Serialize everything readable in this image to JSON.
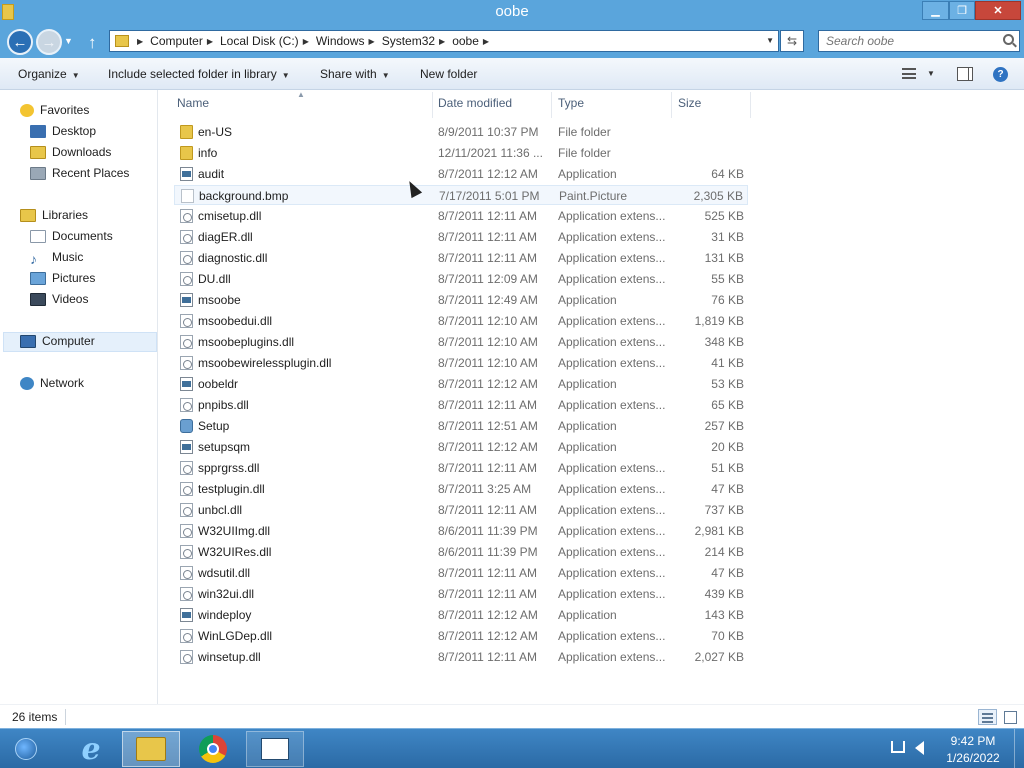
{
  "window": {
    "title": "oobe"
  },
  "address": {
    "crumbs": [
      "Computer",
      "Local Disk (C:)",
      "Windows",
      "System32",
      "oobe"
    ],
    "search_placeholder": "Search oobe"
  },
  "toolbar": {
    "organize": "Organize",
    "include": "Include selected folder in library",
    "share": "Share with",
    "new_folder": "New folder"
  },
  "nav": {
    "favorites": "Favorites",
    "favorites_items": [
      "Desktop",
      "Downloads",
      "Recent Places"
    ],
    "libraries": "Libraries",
    "libraries_items": [
      "Documents",
      "Music",
      "Pictures",
      "Videos"
    ],
    "computer": "Computer",
    "network": "Network"
  },
  "columns": {
    "name": "Name",
    "date": "Date modified",
    "type": "Type",
    "size": "Size"
  },
  "files": [
    {
      "name": "en-US",
      "date": "8/9/2011 10:37 PM",
      "type": "File folder",
      "size": "",
      "icon": "folder-icon"
    },
    {
      "name": "info",
      "date": "12/11/2021 11:36 ...",
      "type": "File folder",
      "size": "",
      "icon": "folder-icon"
    },
    {
      "name": "audit",
      "date": "8/7/2011 12:12 AM",
      "type": "Application",
      "size": "64 KB",
      "icon": "app-icon"
    },
    {
      "name": "background.bmp",
      "date": "7/17/2011 5:01 PM",
      "type": "Paint.Picture",
      "size": "2,305 KB",
      "icon": "bmp-icon"
    },
    {
      "name": "cmisetup.dll",
      "date": "8/7/2011 12:11 AM",
      "type": "Application extens...",
      "size": "525 KB",
      "icon": "dll-icon"
    },
    {
      "name": "diagER.dll",
      "date": "8/7/2011 12:11 AM",
      "type": "Application extens...",
      "size": "31 KB",
      "icon": "dll-icon"
    },
    {
      "name": "diagnostic.dll",
      "date": "8/7/2011 12:11 AM",
      "type": "Application extens...",
      "size": "131 KB",
      "icon": "dll-icon"
    },
    {
      "name": "DU.dll",
      "date": "8/7/2011 12:09 AM",
      "type": "Application extens...",
      "size": "55 KB",
      "icon": "dll-icon"
    },
    {
      "name": "msoobe",
      "date": "8/7/2011 12:49 AM",
      "type": "Application",
      "size": "76 KB",
      "icon": "app-icon"
    },
    {
      "name": "msoobedui.dll",
      "date": "8/7/2011 12:10 AM",
      "type": "Application extens...",
      "size": "1,819 KB",
      "icon": "dll-icon"
    },
    {
      "name": "msoobeplugins.dll",
      "date": "8/7/2011 12:10 AM",
      "type": "Application extens...",
      "size": "348 KB",
      "icon": "dll-icon"
    },
    {
      "name": "msoobewirelessplugin.dll",
      "date": "8/7/2011 12:10 AM",
      "type": "Application extens...",
      "size": "41 KB",
      "icon": "dll-icon"
    },
    {
      "name": "oobeldr",
      "date": "8/7/2011 12:12 AM",
      "type": "Application",
      "size": "53 KB",
      "icon": "app-icon"
    },
    {
      "name": "pnpibs.dll",
      "date": "8/7/2011 12:11 AM",
      "type": "Application extens...",
      "size": "65 KB",
      "icon": "dll-icon"
    },
    {
      "name": "Setup",
      "date": "8/7/2011 12:51 AM",
      "type": "Application",
      "size": "257 KB",
      "icon": "setup-icon"
    },
    {
      "name": "setupsqm",
      "date": "8/7/2011 12:12 AM",
      "type": "Application",
      "size": "20 KB",
      "icon": "app-icon"
    },
    {
      "name": "spprgrss.dll",
      "date": "8/7/2011 12:11 AM",
      "type": "Application extens...",
      "size": "51 KB",
      "icon": "dll-icon"
    },
    {
      "name": "testplugin.dll",
      "date": "8/7/2011 3:25 AM",
      "type": "Application extens...",
      "size": "47 KB",
      "icon": "dll-icon"
    },
    {
      "name": "unbcl.dll",
      "date": "8/7/2011 12:11 AM",
      "type": "Application extens...",
      "size": "737 KB",
      "icon": "dll-icon"
    },
    {
      "name": "W32UIImg.dll",
      "date": "8/6/2011 11:39 PM",
      "type": "Application extens...",
      "size": "2,981 KB",
      "icon": "dll-icon"
    },
    {
      "name": "W32UIRes.dll",
      "date": "8/6/2011 11:39 PM",
      "type": "Application extens...",
      "size": "214 KB",
      "icon": "dll-icon"
    },
    {
      "name": "wdsutil.dll",
      "date": "8/7/2011 12:11 AM",
      "type": "Application extens...",
      "size": "47 KB",
      "icon": "dll-icon"
    },
    {
      "name": "win32ui.dll",
      "date": "8/7/2011 12:11 AM",
      "type": "Application extens...",
      "size": "439 KB",
      "icon": "dll-icon"
    },
    {
      "name": "windeploy",
      "date": "8/7/2011 12:12 AM",
      "type": "Application",
      "size": "143 KB",
      "icon": "app-icon"
    },
    {
      "name": "WinLGDep.dll",
      "date": "8/7/2011 12:12 AM",
      "type": "Application extens...",
      "size": "70 KB",
      "icon": "dll-icon"
    },
    {
      "name": "winsetup.dll",
      "date": "8/7/2011 12:11 AM",
      "type": "Application extens...",
      "size": "2,027 KB",
      "icon": "dll-icon"
    }
  ],
  "hovered_file": "background.bmp",
  "status": {
    "item_count": "26 items"
  },
  "taskbar": {
    "apps": [
      "internet-explorer-icon",
      "file-explorer-icon",
      "chrome-icon",
      "notepad-icon"
    ],
    "time": "9:42 PM",
    "date": "1/26/2022"
  },
  "colors": {
    "chrome": "#5aa5dc",
    "taskbar": "#2b6aa5",
    "selection": "#e5f0fb"
  }
}
